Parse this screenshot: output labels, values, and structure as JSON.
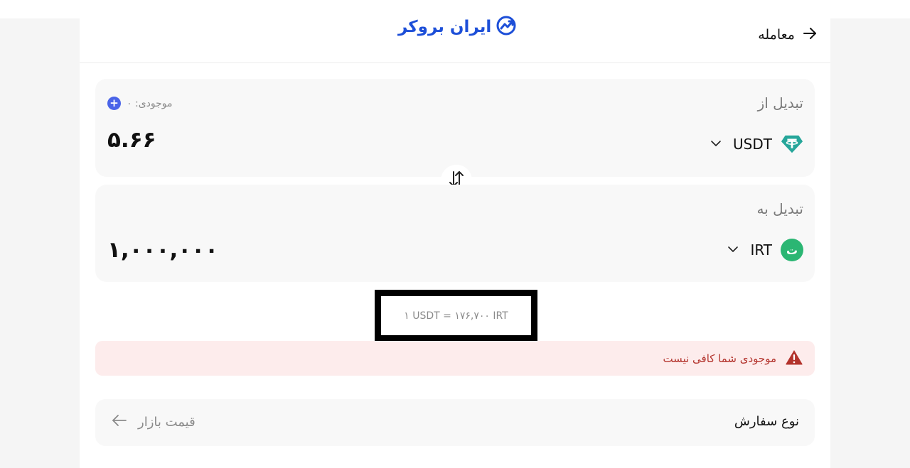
{
  "header": {
    "back_label": "معامله",
    "logo_text": "ایران بروکر"
  },
  "from_card": {
    "title": "تبدیل از",
    "balance_label": "موجودی: ۰",
    "amount": "۵.۶۶",
    "currency_code": "USDT",
    "currency_icon": "tether-icon"
  },
  "to_card": {
    "title": "تبدیل به",
    "amount": "۱,۰۰۰,۰۰۰",
    "currency_code": "IRT",
    "currency_icon_text": "ت"
  },
  "rate": {
    "text": "۱ USDT = ۱۷۶,۷۰۰ IRT"
  },
  "alert": {
    "text": "موجودی شما کافی نیست"
  },
  "order_type": {
    "label": "نوع سفارش",
    "value": "قیمت بازار"
  },
  "colors": {
    "brand": "#1d4fd8",
    "tether": "#26a69a",
    "toman": "#2bb673",
    "alert_bg": "#fdecec",
    "alert_text": "#b3332c",
    "plus": "#4a64e8"
  }
}
